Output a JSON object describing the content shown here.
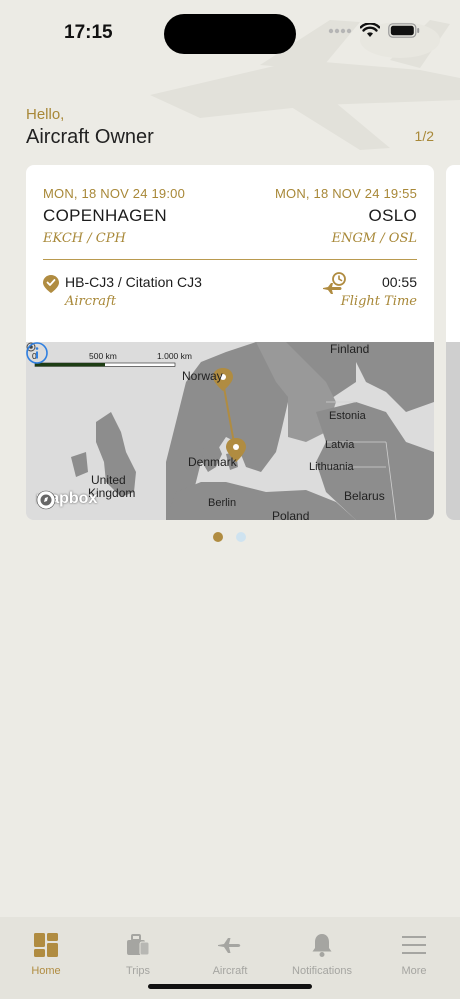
{
  "status_bar": {
    "time": "17:15"
  },
  "greeting": {
    "hello": "Hello,",
    "name": "Aircraft Owner"
  },
  "pager": "1/2",
  "flight": {
    "departure": {
      "datetime": "MON, 18 NOV 24 19:00",
      "city": "COPENHAGEN",
      "codes": "EKCH / CPH"
    },
    "arrival": {
      "datetime": "MON, 18 NOV 24 19:55",
      "city": "OSLO",
      "codes": "ENGM / OSL"
    },
    "aircraft": {
      "name": "HB-CJ3 / Citation CJ3",
      "label": "Aircraft"
    },
    "flight_time": {
      "value": "00:55",
      "label": "Flight Time"
    }
  },
  "map": {
    "scale": {
      "zero": "0",
      "mid": "500 km",
      "end": "1.000 km"
    },
    "labels": {
      "finland": "Finland",
      "norway": "Norway",
      "estonia": "Estonia",
      "latvia": "Latvia",
      "lithuania": "Lithuania",
      "denmark": "Denmark",
      "united_kingdom_1": "United",
      "united_kingdom_2": "Kingdom",
      "belarus": "Belarus",
      "berlin": "Berlin",
      "poland": "Poland"
    },
    "logo": "mapbox"
  },
  "pagination": {
    "pages": 2,
    "current": 1
  },
  "tabs": [
    {
      "label": "Home",
      "icon": "home-grid-icon",
      "active": true
    },
    {
      "label": "Trips",
      "icon": "luggage-icon",
      "active": false
    },
    {
      "label": "Aircraft",
      "icon": "airplane-icon",
      "active": false
    },
    {
      "label": "Notifications",
      "icon": "bell-icon",
      "active": false
    },
    {
      "label": "More",
      "icon": "menu-icon",
      "active": false
    }
  ],
  "colors": {
    "accent": "#b08c41",
    "background": "#ecebe5",
    "inactive": "#a5a5a1",
    "card": "#ffffff",
    "dot_inactive": "#cfe3f0"
  }
}
